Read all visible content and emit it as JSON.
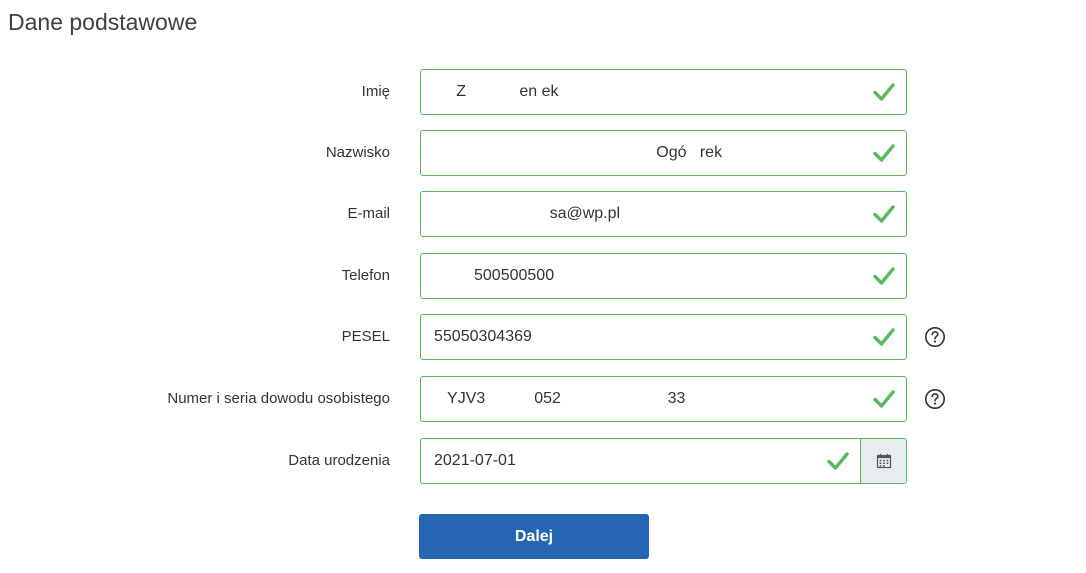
{
  "page": {
    "title": "Dane podstawowe"
  },
  "form": {
    "fields": [
      {
        "label": "Imię",
        "value": "     Z            en ek"
      },
      {
        "label": "Nazwisko",
        "value": "                                                  Ogó   rek"
      },
      {
        "label": "E-mail",
        "value": "                          sa@wp.pl"
      },
      {
        "label": "Telefon",
        "value": "         500500500"
      },
      {
        "label": "PESEL",
        "value": "55050304369"
      },
      {
        "label": "Numer i seria dowodu osobistego",
        "value": "   YJV3           052                        33"
      },
      {
        "label": "Data urodzenia",
        "value": "2021-07-01"
      }
    ],
    "submit_label": "Dalej"
  },
  "icons": {
    "valid": "check-icon",
    "help": "question-circle-icon",
    "date_picker": "calendar-icon"
  },
  "colors": {
    "valid_border": "#5cb85c",
    "valid_check": "#5cb85c",
    "primary_button": "#2566b3",
    "addon_background": "#e9ecef"
  }
}
